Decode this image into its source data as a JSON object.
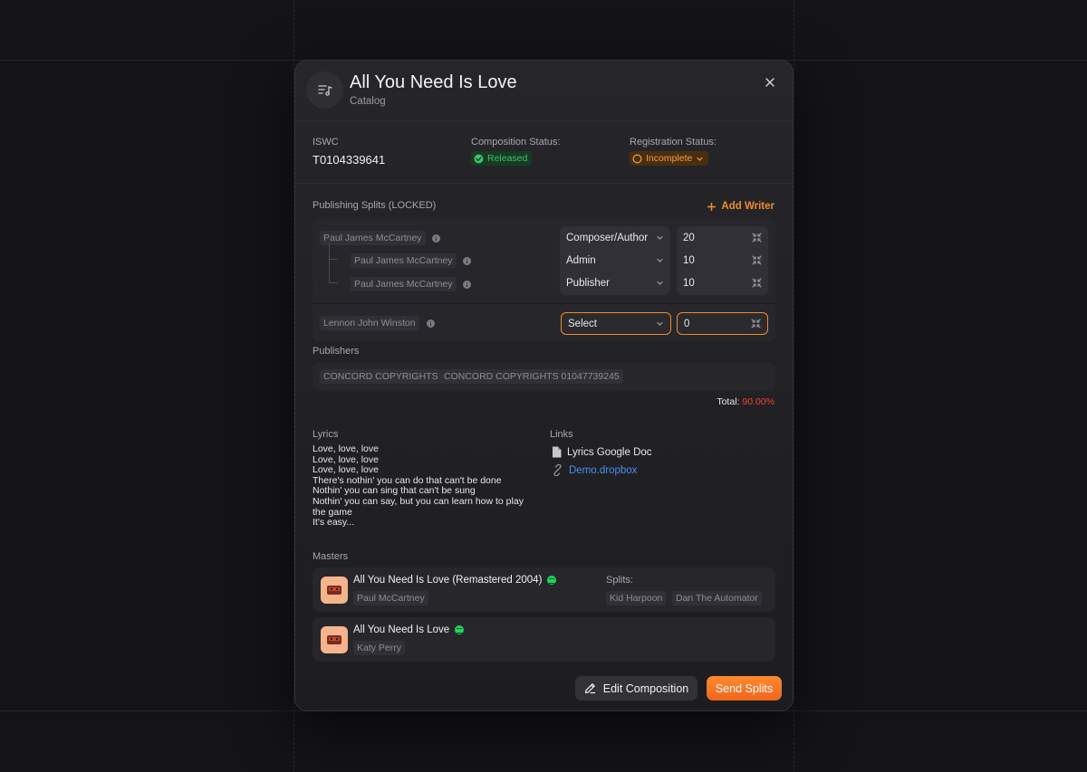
{
  "header": {
    "title": "All You Need Is Love",
    "subtitle": "Catalog"
  },
  "meta": {
    "iswc_label": "ISWC",
    "iswc_value": "T0104339641",
    "composition_status_label": "Composition Status:",
    "composition_status_value": "Released",
    "registration_status_label": "Registration Status:",
    "registration_status_value": "Incomplete"
  },
  "splits": {
    "label": "Publishing Splits (LOCKED)",
    "add_writer_label": "Add Writer",
    "writers": [
      {
        "name": "Paul James McCartney",
        "rows": [
          {
            "party": "Paul James McCartney",
            "role": "Composer/Author",
            "pct": "20"
          },
          {
            "party": "Paul James McCartney",
            "role": "Admin",
            "pct": "10"
          },
          {
            "party": "Paul James McCartney",
            "role": "Publisher",
            "pct": "10"
          }
        ]
      },
      {
        "name": "Lennon John Winston",
        "rows": [
          {
            "party": "Lennon John Winston",
            "role": "Select",
            "pct": "0"
          }
        ]
      }
    ]
  },
  "publishers": {
    "label": "Publishers",
    "items": [
      "CONCORD COPYRIGHTS",
      "CONCORD COPYRIGHTS 01047739245"
    ],
    "total_label": "Total:",
    "total_value": "90.00%"
  },
  "lyrics": {
    "label": "Lyrics",
    "lines": [
      "Love, love, love",
      "Love, love, love",
      "Love, love, love",
      "There's nothin' you can do that can't be done",
      "Nothin' you can sing that can't be sung",
      "Nothin' you can say, but you can learn how to play the game",
      "It's easy..."
    ]
  },
  "links": {
    "label": "Links",
    "items": [
      {
        "text": "Lyrics Google Doc",
        "icon": "document-icon",
        "color": "#e8e8ea"
      },
      {
        "text": "Demo.dropbox",
        "icon": "link-icon",
        "color": "#4d8bf0"
      }
    ]
  },
  "masters": {
    "label": "Masters",
    "splits_label": "Splits:",
    "items": [
      {
        "title": "All You Need Is Love (Remastered 2004)",
        "artist": "Paul McCartney",
        "splits": [
          "Kid Harpoon",
          "Dan The Automator"
        ]
      },
      {
        "title": "All You Need Is Love",
        "artist": "Katy Perry",
        "splits": []
      }
    ]
  },
  "actions": {
    "edit_label": "Edit Composition",
    "send_label": "Send Splits"
  },
  "colors": {
    "accent": "#f08a2c",
    "released": "#3ec266",
    "incomplete": "#f3a13a",
    "total_alert": "#f0452c",
    "link": "#4d8bf0"
  }
}
